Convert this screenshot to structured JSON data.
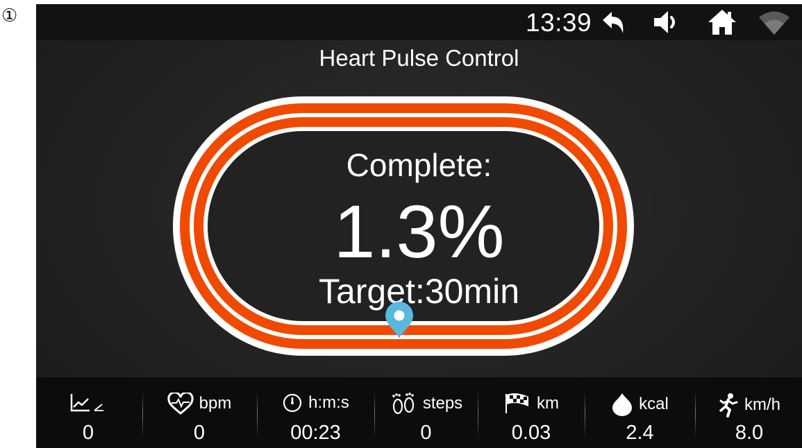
{
  "marker": "①",
  "status_bar": {
    "time": "13:39",
    "icons": [
      "back-arrow-icon",
      "volume-icon",
      "home-icon",
      "wifi-icon"
    ]
  },
  "title": "Heart Pulse Control",
  "progress": {
    "complete_label": "Complete:",
    "value": "1.3%",
    "fraction": 0.013,
    "target": "Target:30min"
  },
  "colors": {
    "track": "#f04a00",
    "pin": "#5ab8e0",
    "background": "#222222"
  },
  "stats": [
    {
      "icon": "incline-icon",
      "unit": "",
      "value": "0"
    },
    {
      "icon": "heart-icon",
      "unit": "bpm",
      "value": "0"
    },
    {
      "icon": "stopwatch-icon",
      "unit": "h:m:s",
      "value": "00:23"
    },
    {
      "icon": "footprints-icon",
      "unit": "steps",
      "value": "0"
    },
    {
      "icon": "checkered-flag-icon",
      "unit": "km",
      "value": "0.03"
    },
    {
      "icon": "flame-icon",
      "unit": "kcal",
      "value": "2.4"
    },
    {
      "icon": "runner-icon",
      "unit": "km/h",
      "value": "8.0"
    }
  ]
}
